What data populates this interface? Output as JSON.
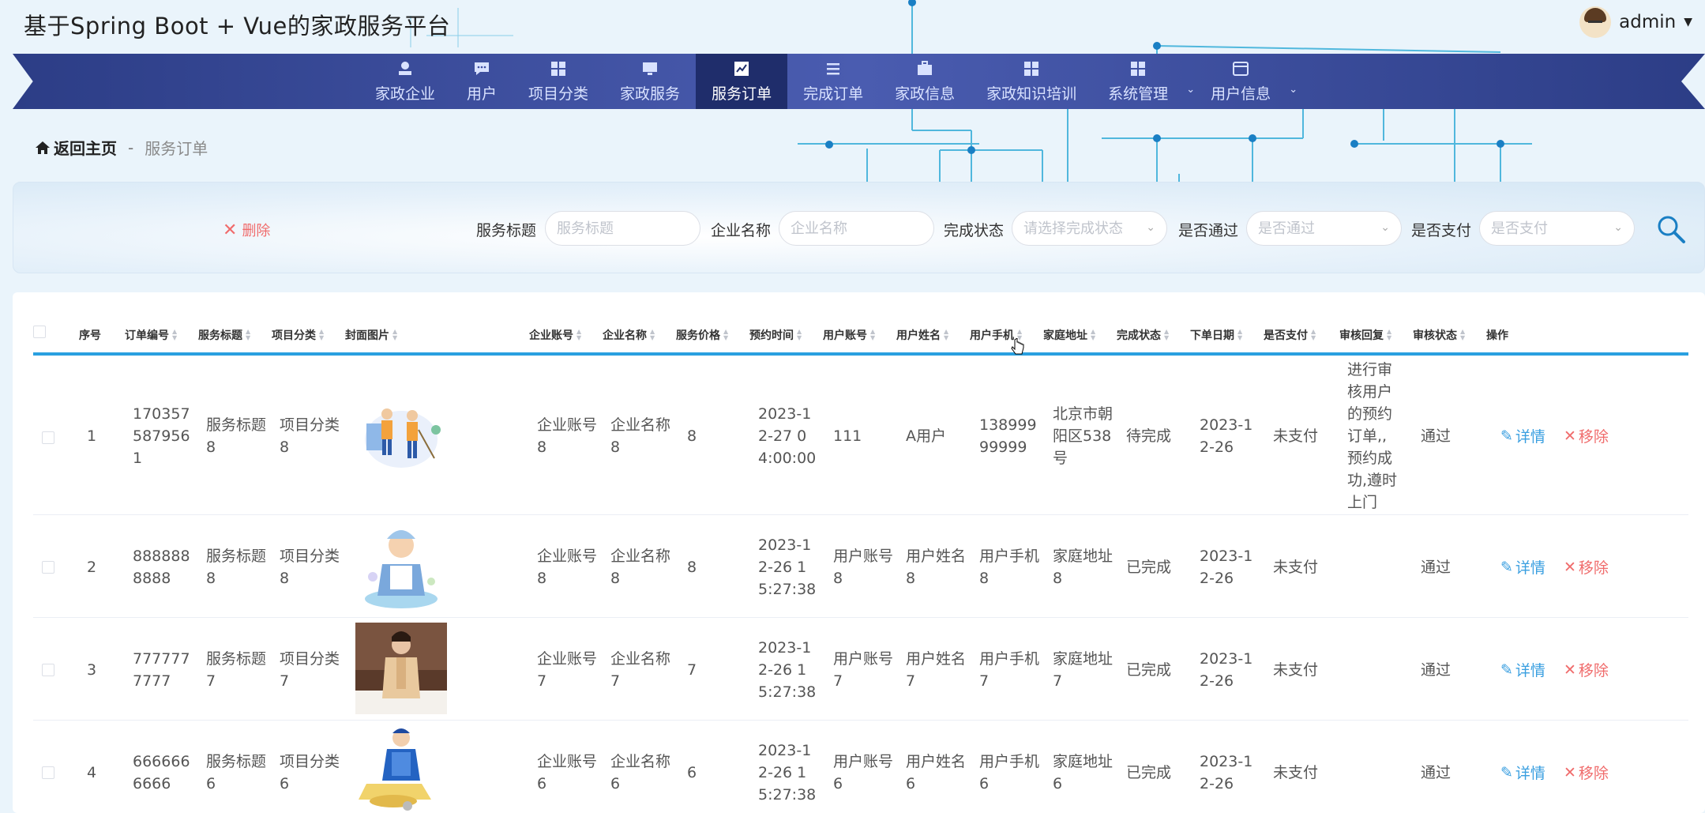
{
  "app": {
    "title": "基于Spring Boot + Vue的家政服务平台",
    "user": "admin"
  },
  "nav": {
    "items": [
      {
        "label": "家政企业",
        "icon": "user-stamp-icon"
      },
      {
        "label": "用户",
        "icon": "chat-icon"
      },
      {
        "label": "项目分类",
        "icon": "grid-icon"
      },
      {
        "label": "家政服务",
        "icon": "monitor-icon"
      },
      {
        "label": "服务订单",
        "icon": "chart-icon",
        "active": true
      },
      {
        "label": "完成订单",
        "icon": "list-icon"
      },
      {
        "label": "家政信息",
        "icon": "briefcase-icon"
      },
      {
        "label": "家政知识培训",
        "icon": "grid-icon"
      },
      {
        "label": "系统管理",
        "icon": "grid-icon",
        "dropdown": true
      },
      {
        "label": "用户信息",
        "icon": "card-icon",
        "dropdown": true
      }
    ]
  },
  "breadcrumb": {
    "home": "返回主页",
    "sep": "-",
    "current": "服务订单"
  },
  "search": {
    "delete_label": "删除",
    "title_label": "服务标题",
    "title_placeholder": "服务标题",
    "company_label": "企业名称",
    "company_placeholder": "企业名称",
    "status_label": "完成状态",
    "status_placeholder": "请选择完成状态",
    "pass_label": "是否通过",
    "pass_placeholder": "是否通过",
    "pay_label": "是否支付",
    "pay_placeholder": "是否支付"
  },
  "table": {
    "headers": [
      "序号",
      "订单编号",
      "服务标题",
      "项目分类",
      "封面图片",
      "企业账号",
      "企业名称",
      "服务价格",
      "预约时间",
      "用户账号",
      "用户姓名",
      "用户手机",
      "家庭地址",
      "完成状态",
      "下单日期",
      "是否支付",
      "审核回复",
      "审核状态",
      "操作"
    ],
    "detail_label": "详情",
    "remove_label": "移除",
    "rows": [
      {
        "idx": "1",
        "order_no": "1703575879561",
        "title": "服务标题8",
        "category": "项目分类8",
        "account": "企业账号8",
        "company": "企业名称8",
        "price": "8",
        "time": "2023-12-27 04:00:00",
        "user_account": "111",
        "user_name": "A用户",
        "phone": "13899999999",
        "address": "北京市朝阳区538号",
        "status": "待完成",
        "date": "2023-12-26",
        "paid": "未支付",
        "reply": "进行审核用户的预约订单,,预约成功,遵时上门",
        "audit": "通过"
      },
      {
        "idx": "2",
        "order_no": "8888888888",
        "title": "服务标题8",
        "category": "项目分类8",
        "account": "企业账号8",
        "company": "企业名称8",
        "price": "8",
        "time": "2023-12-26 15:27:38",
        "user_account": "用户账号8",
        "user_name": "用户姓名8",
        "phone": "用户手机8",
        "address": "家庭地址8",
        "status": "已完成",
        "date": "2023-12-26",
        "paid": "未支付",
        "reply": "",
        "audit": "通过"
      },
      {
        "idx": "3",
        "order_no": "7777777777",
        "title": "服务标题7",
        "category": "项目分类7",
        "account": "企业账号7",
        "company": "企业名称7",
        "price": "7",
        "time": "2023-12-26 15:27:38",
        "user_account": "用户账号7",
        "user_name": "用户姓名7",
        "phone": "用户手机7",
        "address": "家庭地址7",
        "status": "已完成",
        "date": "2023-12-26",
        "paid": "未支付",
        "reply": "",
        "audit": "通过"
      },
      {
        "idx": "4",
        "order_no": "6666666666",
        "title": "服务标题6",
        "category": "项目分类6",
        "account": "企业账号6",
        "company": "企业名称6",
        "price": "6",
        "time": "2023-12-26 15:27:38",
        "user_account": "用户账号6",
        "user_name": "用户姓名6",
        "phone": "用户手机6",
        "address": "家庭地址6",
        "status": "已完成",
        "date": "2023-12-26",
        "paid": "未支付",
        "reply": "",
        "audit": "通过"
      }
    ]
  }
}
